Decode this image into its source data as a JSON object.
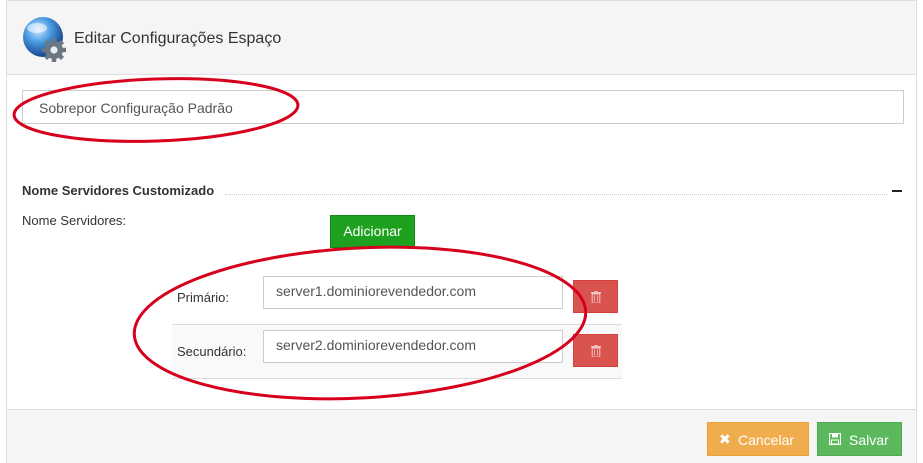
{
  "header": {
    "title": "Editar Configurações Espaço",
    "icon": "gear-globe-icon"
  },
  "override": {
    "label": "Sobrepor Configuração Padrão"
  },
  "section": {
    "title": "Nome Servidores Customizado",
    "collapse_icon": "minus-icon"
  },
  "nameservers": {
    "label": "Nome Servidores:",
    "add_label": "Adicionar",
    "rows": [
      {
        "label": "Primário:",
        "value": "server1.dominiorevendedor.com",
        "delete_icon": "trash-icon"
      },
      {
        "label": "Secundário:",
        "value": "server2.dominiorevendedor.com",
        "delete_icon": "trash-icon"
      }
    ]
  },
  "footer": {
    "cancel_label": "Cancelar",
    "cancel_icon": "close-icon",
    "save_label": "Salvar",
    "save_icon": "floppy-disk-icon"
  },
  "colors": {
    "add_button": "#1ea11e",
    "delete_button": "#d9534f",
    "cancel_button": "#f0ad4e",
    "save_button": "#5cb85c",
    "annotation": "#d7001c"
  }
}
